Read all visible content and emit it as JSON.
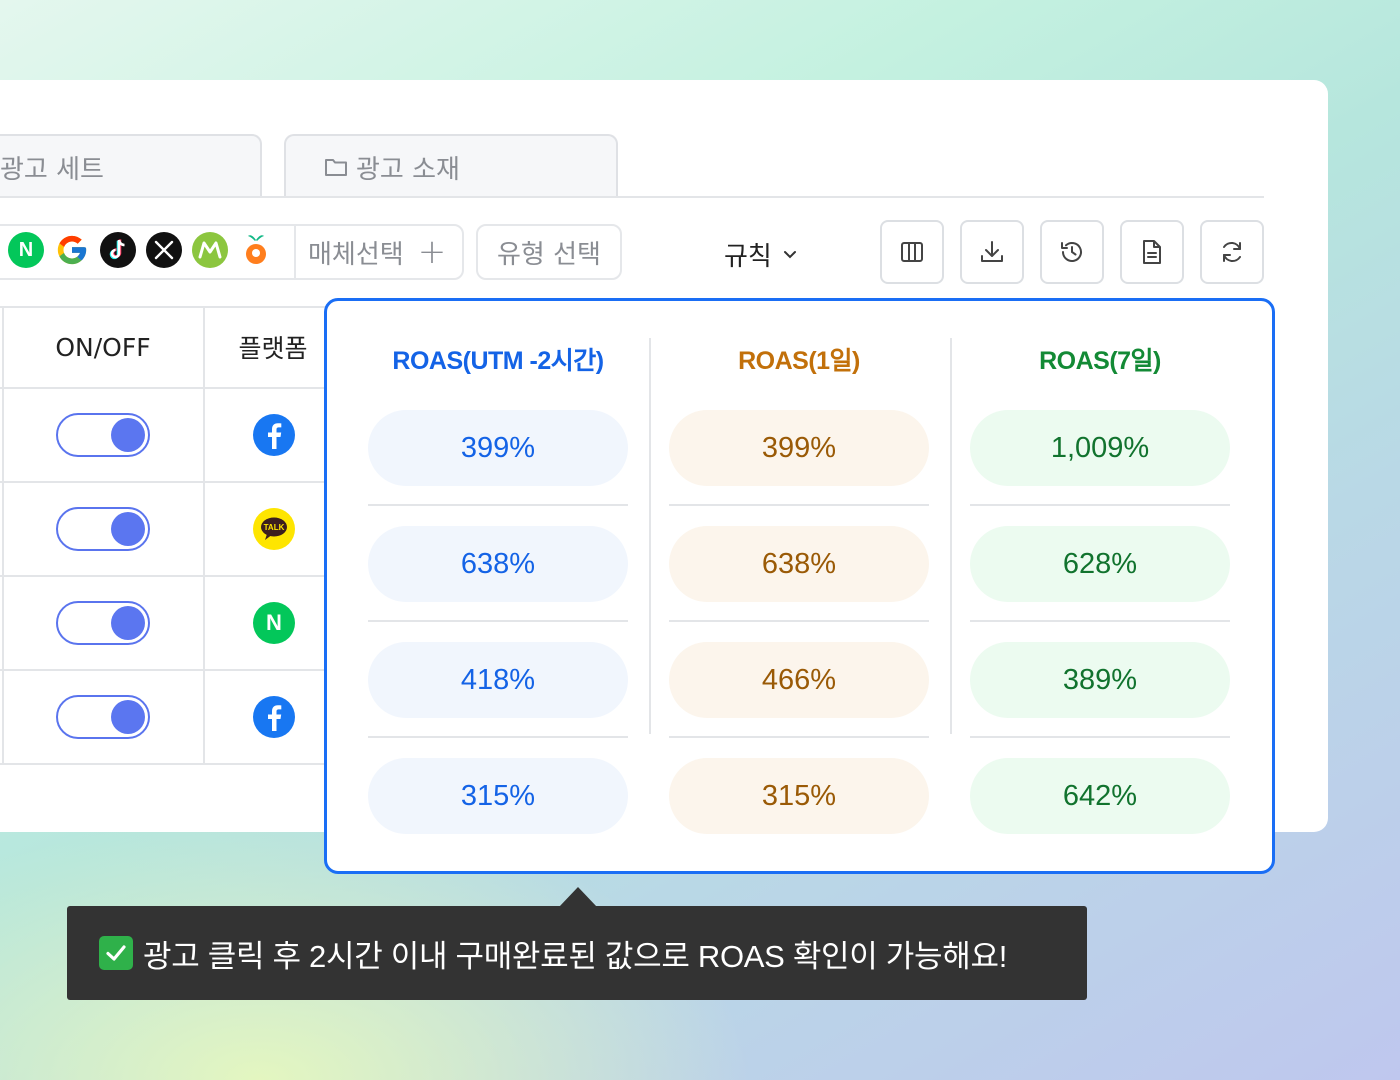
{
  "tabs": {
    "ad_sets": "광고 세트",
    "ad_creative": "광고 소재"
  },
  "filters": {
    "media_icons": [
      "naver-icon",
      "google-icon",
      "tiktok-icon",
      "x-icon",
      "m-icon",
      "carrot-icon"
    ],
    "naver_letter": "N",
    "media_select_label": "매체선택",
    "media_select_plus": "+",
    "type_select_label": "유형 선택",
    "rules_label": "규칙"
  },
  "toolbar": {
    "icons": [
      "columns-icon",
      "download-icon",
      "history-icon",
      "document-icon",
      "refresh-icon"
    ]
  },
  "table": {
    "headers": {
      "onoff": "ON/OFF",
      "platform": "플랫폼"
    },
    "rows": [
      {
        "on": true,
        "platform": "facebook-icon"
      },
      {
        "on": true,
        "platform": "kakao-talk-icon",
        "platform_text": "TALK"
      },
      {
        "on": true,
        "platform": "naver-icon",
        "platform_text": "N"
      },
      {
        "on": true,
        "platform": "facebook-icon"
      }
    ]
  },
  "roas": {
    "columns": [
      {
        "title": "ROAS(UTM -2시간)",
        "color": "#1463e6",
        "values": [
          "399%",
          "638%",
          "418%",
          "315%"
        ]
      },
      {
        "title": "ROAS(1일)",
        "color": "#c2700a",
        "values": [
          "399%",
          "638%",
          "466%",
          "315%"
        ]
      },
      {
        "title": "ROAS(7일)",
        "color": "#138a35",
        "values": [
          "1,009%",
          "628%",
          "389%",
          "642%"
        ]
      }
    ]
  },
  "tooltip": {
    "text": "광고 클릭 후 2시간 이내 구매완료된 값으로 ROAS 확인이 가능해요!"
  },
  "colors": {
    "accent": "#1a6ef5",
    "toggle": "#5b76f0",
    "tooltip_bg": "#333333"
  }
}
